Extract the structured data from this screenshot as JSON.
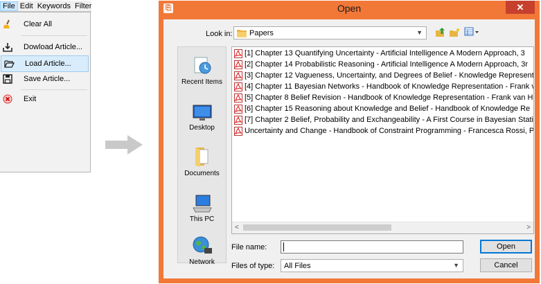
{
  "menubar": {
    "items": [
      "File",
      "Edit",
      "Keywords",
      "Filter"
    ]
  },
  "file_menu": {
    "items": [
      {
        "label": "Clear All",
        "icon": "broom-icon"
      },
      {
        "label": "Dowload Article...",
        "icon": "download-icon"
      },
      {
        "label": "Load Article...",
        "icon": "open-folder-icon",
        "highlighted": true
      },
      {
        "label": "Save Article...",
        "icon": "floppy-disk-icon"
      },
      {
        "label": "Exit",
        "icon": "exit-icon"
      }
    ]
  },
  "dialog": {
    "title": "Open",
    "close_label": "✕",
    "look_in_label": "Look in:",
    "look_in_value": "Papers",
    "places": [
      "Recent Items",
      "Desktop",
      "Documents",
      "This PC",
      "Network"
    ],
    "files": [
      "[1] Chapter 13 Quantifying Uncertainty - Artificial Intelligence A Modern Approach, 3",
      "[2] Chapter 14 Probabilistic Reasoning - Artificial Intelligence A Modern Approach, 3r",
      "[3] Chapter 12 Vagueness, Uncertainty, and Degrees of Belief - Knowledge Representa",
      "[4] Chapter 11 Bayesian Networks - Handbook of Knowledge Representation - Frank v",
      "[5] Chapter 8 Belief Revision - Handbook of Knowledge Representation - Frank van H",
      "[6] Chapter 15 Reasoning about Knowledge and Belief -  Handbook of Knowledge Re",
      "[7] Chapter 2 Belief, Probability and Exchangeability - A First Course in Bayesian Statis",
      "Uncertainty and Change - Handbook of Constraint Programming - Francesca Rossi, P"
    ],
    "file_name_label": "File name:",
    "file_name_value": "",
    "files_of_type_label": "Files of type:",
    "files_of_type_value": "All Files",
    "open_button": "Open",
    "cancel_button": "Cancel"
  },
  "colors": {
    "dialog_frame": "#f27838",
    "close_button": "#c7402d",
    "highlight": "#d9ecfb"
  }
}
